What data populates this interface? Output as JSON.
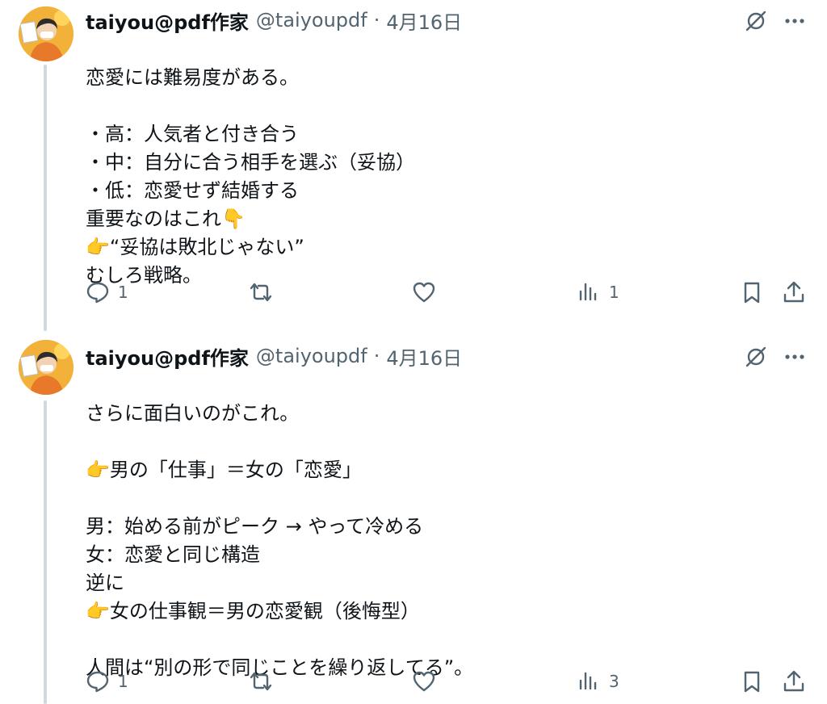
{
  "colors": {
    "text": "#0f1419",
    "secondary": "#536471",
    "thread_line": "#cfd9de",
    "emoji": "#f4c13a"
  },
  "posts": [
    {
      "author_name": "taiyou@pdf作家",
      "handle": "@taiyoupdf",
      "separator": "·",
      "date": "4月16日",
      "lines": [
        "恋愛には難易度がある。",
        "",
        "・高：人気者と付き合う",
        "・中：自分に合う相手を選ぶ（妥協）",
        "・低：恋愛せず結婚する",
        "重要なのはこれ👇",
        "👉“妥協は敗北じゃない”",
        "むしろ戦略。"
      ],
      "stats": {
        "replies": "1",
        "views": "1"
      },
      "icons": [
        "grok-icon",
        "more-icon",
        "reply-icon",
        "repost-icon",
        "like-icon",
        "views-icon",
        "bookmark-icon",
        "share-icon"
      ]
    },
    {
      "author_name": "taiyou@pdf作家",
      "handle": "@taiyoupdf",
      "separator": "·",
      "date": "4月16日",
      "lines": [
        "さらに面白いのがこれ。",
        "",
        "👉男の「仕事」＝女の「恋愛」",
        "",
        "男：始める前がピーク → やって冷める",
        "女：恋愛と同じ構造",
        "逆に",
        "👉女の仕事観＝男の恋愛観（後悔型）",
        "",
        "人間は“別の形で同じことを繰り返してる”。"
      ],
      "stats": {
        "replies": "1",
        "views": "3"
      },
      "icons": [
        "grok-icon",
        "more-icon",
        "reply-icon",
        "repost-icon",
        "like-icon",
        "views-icon",
        "bookmark-icon",
        "share-icon"
      ]
    }
  ]
}
